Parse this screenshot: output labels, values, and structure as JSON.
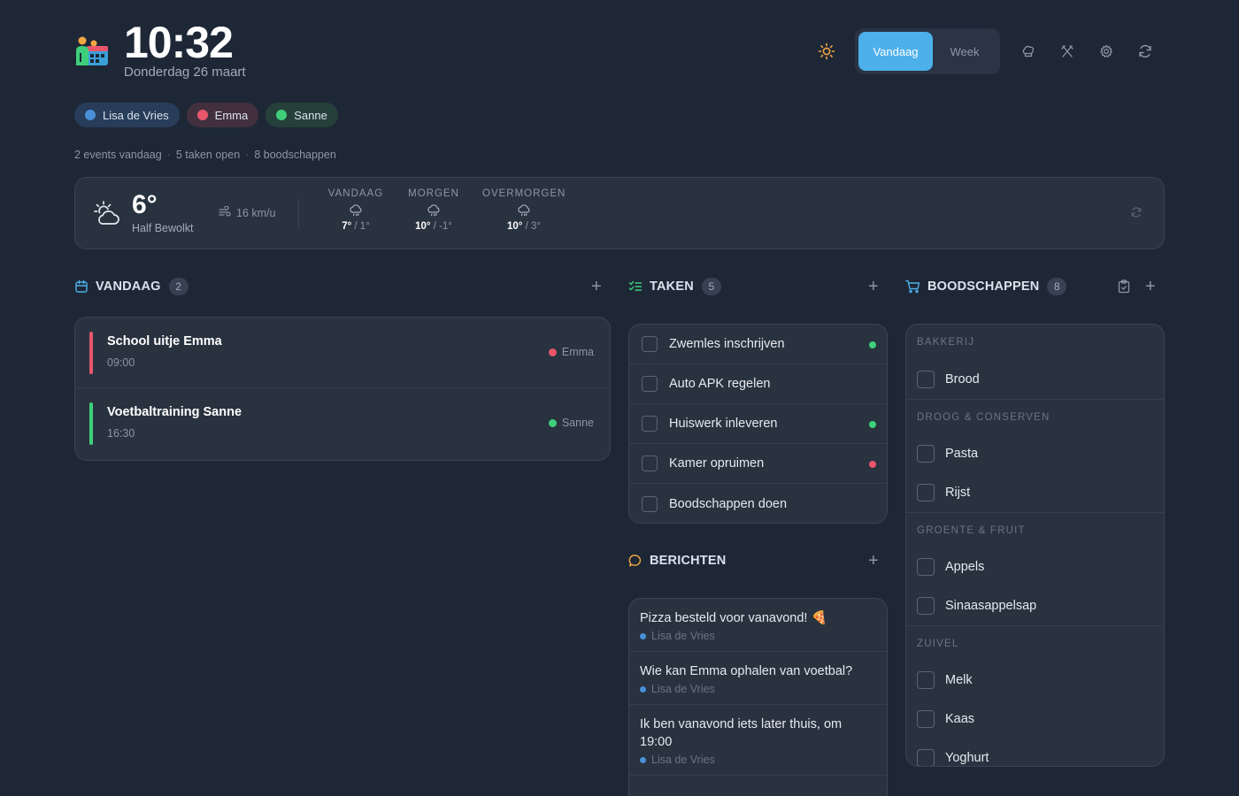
{
  "header": {
    "time": "10:32",
    "date": "Donderdag 26 maart",
    "logo_icon": "family-calendar-logo-icon",
    "view_toggle": {
      "today": "Vandaag",
      "week": "Week",
      "active": "today"
    },
    "icons": [
      "sun-icon",
      "chef-hat-icon",
      "utensils-icon",
      "gear-icon",
      "refresh-icon"
    ]
  },
  "members": [
    {
      "name": "Lisa de Vries",
      "color": "#4a90d9",
      "bg": "#273d5a"
    },
    {
      "name": "Emma",
      "color": "#e8566c",
      "bg": "#43303f"
    },
    {
      "name": "Sanne",
      "color": "#3ecf7a",
      "bg": "#25403a"
    }
  ],
  "summary": {
    "events": "2 events vandaag",
    "tasks": "5 taken open",
    "shopping": "8 boodschappen"
  },
  "weather": {
    "temp": "6°",
    "desc": "Half Bewolkt",
    "wind": "16 km/u",
    "forecast": [
      {
        "day": "VANDAAG",
        "hi": "7°",
        "lo": "1°"
      },
      {
        "day": "MORGEN",
        "hi": "10°",
        "lo": "-1°"
      },
      {
        "day": "OVERMORGEN",
        "hi": "10°",
        "lo": "3°"
      }
    ]
  },
  "today": {
    "title": "VANDAAG",
    "count": "2",
    "events": [
      {
        "title": "School uitje Emma",
        "time": "09:00",
        "who": "Emma",
        "color": "#e8566c"
      },
      {
        "title": "Voetbaltraining Sanne",
        "time": "16:30",
        "who": "Sanne",
        "color": "#3ecf7a"
      }
    ]
  },
  "tasks": {
    "title": "TAKEN",
    "count": "5",
    "items": [
      {
        "label": "Zwemles inschrijven",
        "dot": "#3ecf7a"
      },
      {
        "label": "Auto APK regelen",
        "dot": ""
      },
      {
        "label": "Huiswerk inleveren",
        "dot": "#3ecf7a"
      },
      {
        "label": "Kamer opruimen",
        "dot": "#e8566c"
      },
      {
        "label": "Boodschappen doen",
        "dot": ""
      }
    ]
  },
  "messages": {
    "title": "BERICHTEN",
    "items": [
      {
        "text": "Pizza besteld voor vanavond! 🍕",
        "from": "Lisa de Vries"
      },
      {
        "text": "Wie kan Emma ophalen van voetbal?",
        "from": "Lisa de Vries"
      },
      {
        "text": "Ik ben vanavond iets later thuis, om 19:00",
        "from": "Lisa de Vries"
      }
    ]
  },
  "shopping": {
    "title": "BOODSCHAPPEN",
    "count": "8",
    "groups": [
      {
        "name": "BAKKERIJ",
        "items": [
          "Brood"
        ]
      },
      {
        "name": "DROOG & CONSERVEN",
        "items": [
          "Pasta",
          "Rijst"
        ]
      },
      {
        "name": "GROENTE & FRUIT",
        "items": [
          "Appels",
          "Sinaasappelsap"
        ]
      },
      {
        "name": "ZUIVEL",
        "items": [
          "Melk",
          "Kaas",
          "Yoghurt"
        ]
      }
    ]
  },
  "colors": {
    "accent": "#4db0ea",
    "background": "#1e2736",
    "card": "#29323f"
  }
}
